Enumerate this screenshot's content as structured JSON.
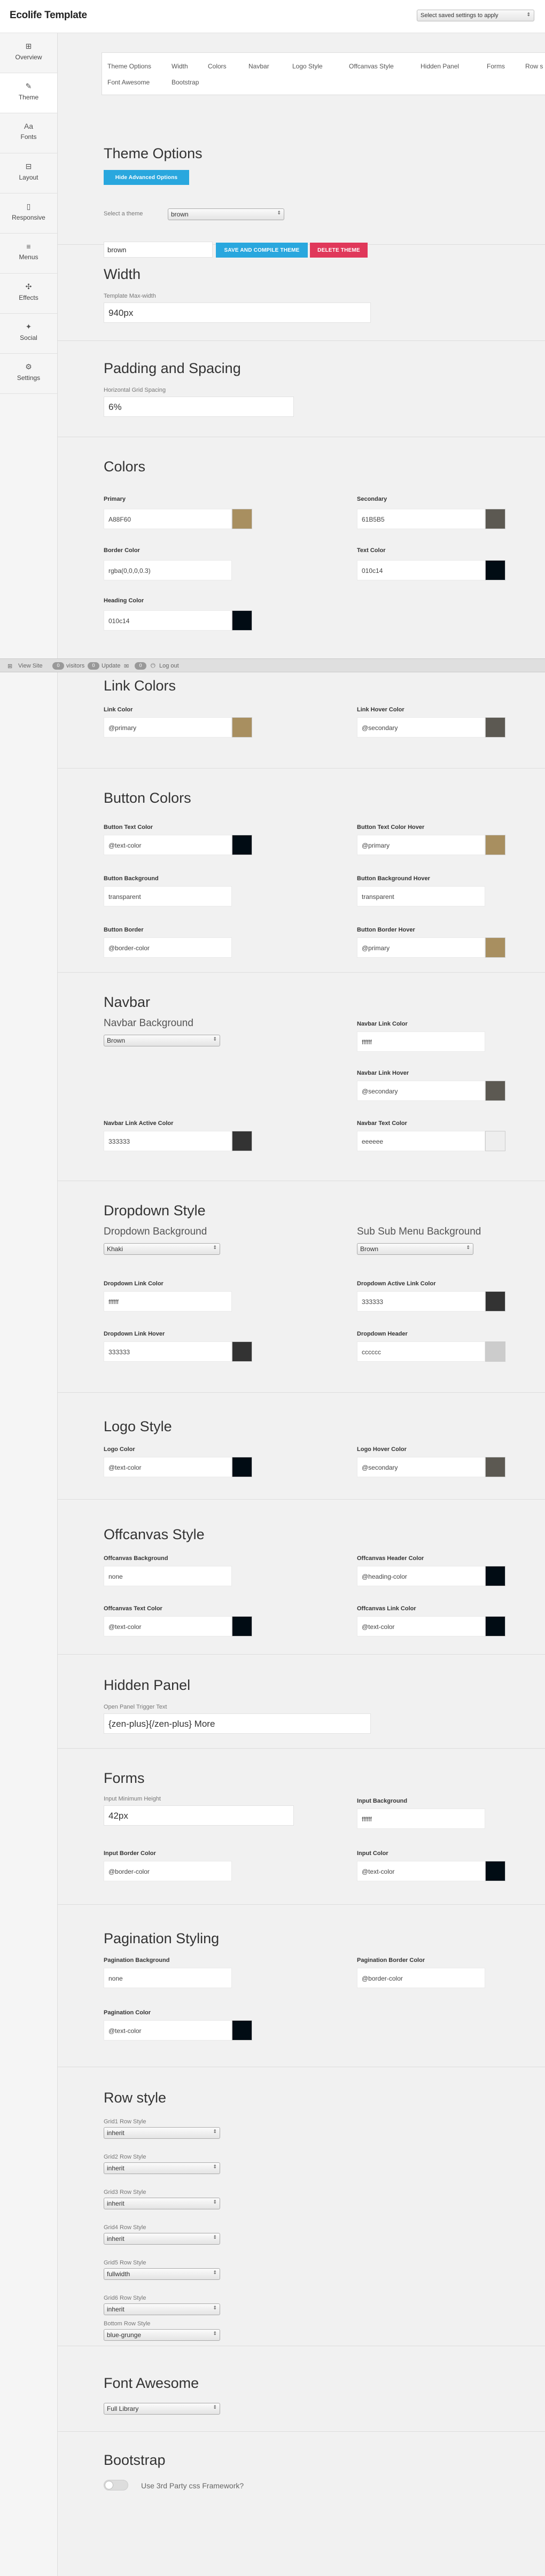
{
  "app": {
    "title": "Ecolife Template"
  },
  "saved_settings": {
    "label": "Select saved settings to apply"
  },
  "sidebar": [
    {
      "label": "Overview",
      "icon": "grid-icon"
    },
    {
      "label": "Theme",
      "icon": "brush-icon"
    },
    {
      "label": "Fonts",
      "icon": "font-icon"
    },
    {
      "label": "Layout",
      "icon": "layout-icon"
    },
    {
      "label": "Responsive",
      "icon": "responsive-icon"
    },
    {
      "label": "Menus",
      "icon": "menu-icon"
    },
    {
      "label": "Effects",
      "icon": "effects-icon"
    },
    {
      "label": "Social",
      "icon": "twitter-icon"
    },
    {
      "label": "Settings",
      "icon": "gear-icon"
    }
  ],
  "tabs": [
    "Theme Options",
    "Width",
    "Colors",
    "Navbar",
    "Logo Style",
    "Offcanvas Style",
    "Hidden Panel",
    "Forms",
    "Row s",
    "Font Awesome",
    "Bootstrap"
  ],
  "theme_options": {
    "title": "Theme Options",
    "hide_advanced": "Hide Advanced Options",
    "select_label": "Select a theme",
    "select_value": "brown",
    "name_value": "brown",
    "save_compile": "SAVE AND COMPILE THEME",
    "delete": "DELETE THEME"
  },
  "width": {
    "title": "Width",
    "label": "Template Max-width",
    "value": "940px"
  },
  "padding": {
    "title": "Padding and Spacing",
    "label": "Horizontal Grid Spacing",
    "value": "6%"
  },
  "colors": {
    "title": "Colors",
    "primary_label": "Primary",
    "primary_value": "A88F60",
    "primary_color": "#a88f60",
    "secondary_label": "Secondary",
    "secondary_value": "61B5B5",
    "secondary_color": "#5c5952",
    "border_label": "Border Color",
    "border_value": "rgba(0,0,0,0.3)",
    "text_label": "Text Color",
    "text_value": "010c14",
    "text_color": "#010c14",
    "heading_label": "Heading Color",
    "heading_value": "010c14",
    "heading_color": "#010c14"
  },
  "divider": {
    "view_site": "View Site",
    "visitors_count": "0",
    "visitors_label": "visitors",
    "updates_count": "0",
    "updates_label": "Update",
    "comments_count": "0",
    "log_out": "Log out"
  },
  "link_colors": {
    "title": "Link Colors",
    "link_label": "Link Color",
    "link_value": "@primary",
    "link_color": "#a88f60",
    "hover_label": "Link Hover Color",
    "hover_value": "@secondary",
    "hover_color": "#5c5952"
  },
  "button_colors": {
    "title": "Button Colors",
    "text_label": "Button Text Color",
    "text_value": "@text-color",
    "text_color": "#010c14",
    "text_hover_label": "Button Text Color Hover",
    "text_hover_value": "@primary",
    "text_hover_color": "#a88f60",
    "bg_label": "Button Background",
    "bg_value": "transparent",
    "bg_hover_label": "Button Background Hover",
    "bg_hover_value": "transparent",
    "border_label": "Button Border",
    "border_value": "@border-color",
    "border_hover_label": "Button Border Hover",
    "border_hover_value": "@primary",
    "border_hover_color": "#a88f60"
  },
  "navbar": {
    "title": "Navbar",
    "bg_label": "Navbar Background",
    "bg_value": "Brown",
    "link_label": "Navbar Link Color",
    "link_value": "ffffff",
    "hover_label": "Navbar Link Hover",
    "hover_value": "@secondary",
    "hover_color": "#5c5952",
    "active_label": "Navbar Link Active Color",
    "active_value": "333333",
    "active_color": "#333333",
    "text_label": "Navbar Text Color",
    "text_value": "eeeeee",
    "text_color": "#eeeeee"
  },
  "dropdown": {
    "title": "Dropdown Style",
    "bg_label": "Dropdown Background",
    "bg_value": "Khaki",
    "sub_label": "Sub Sub Menu Background",
    "sub_value": "Brown",
    "link_label": "Dropdown Link Color",
    "link_value": "ffffff",
    "active_label": "Dropdown Active Link Color",
    "active_value": "333333",
    "active_color": "#333333",
    "hover_label": "Dropdown Link Hover",
    "hover_value": "333333",
    "hover_color": "#333333",
    "header_label": "Dropdown Header",
    "header_value": "cccccc",
    "header_color": "#cccccc"
  },
  "logo": {
    "title": "Logo Style",
    "color_label": "Logo Color",
    "color_value": "@text-color",
    "color_color": "#010c14",
    "hover_label": "Logo Hover Color",
    "hover_value": "@secondary",
    "hover_color": "#5c5952"
  },
  "offcanvas": {
    "title": "Offcanvas Style",
    "bg_label": "Offcanvas Background",
    "bg_value": "none",
    "header_label": "Offcanvas Header Color",
    "header_value": "@heading-color",
    "header_color": "#010c14",
    "text_label": "Offcanvas Text Color",
    "text_value": "@text-color",
    "text_color": "#010c14",
    "link_label": "Offcanvas Link Color",
    "link_value": "@text-color",
    "link_color": "#010c14"
  },
  "hidden_panel": {
    "title": "Hidden Panel",
    "label": "Open Panel Trigger Text",
    "value": "{zen-plus}{/zen-plus} More"
  },
  "forms": {
    "title": "Forms",
    "height_label": "Input Minimum Height",
    "height_value": "42px",
    "bg_label": "Input Background",
    "bg_value": "ffffff",
    "border_label": "Input Border Color",
    "border_value": "@border-color",
    "color_label": "Input Color",
    "color_value": "@text-color",
    "color_color": "#010c14"
  },
  "pagination": {
    "title": "Pagination Styling",
    "bg_label": "Pagination Background",
    "bg_value": "none",
    "border_label": "Pagination Border Color",
    "border_value": "@border-color",
    "color_label": "Pagination Color",
    "color_value": "@text-color",
    "color_color": "#010c14"
  },
  "row_style": {
    "title": "Row style",
    "rows": [
      {
        "label": "Grid1 Row Style",
        "value": "inherit"
      },
      {
        "label": "Grid2 Row Style",
        "value": "inherit"
      },
      {
        "label": "Grid3 Row Style",
        "value": "inherit"
      },
      {
        "label": "Grid4 Row Style",
        "value": "inherit"
      },
      {
        "label": "Grid5 Row Style",
        "value": "fullwidth"
      },
      {
        "label": "Grid6 Row Style",
        "value": "inherit"
      },
      {
        "label": "Bottom Row Style",
        "value": "blue-grunge"
      }
    ]
  },
  "font_awesome": {
    "title": "Font Awesome",
    "value": "Full Library"
  },
  "bootstrap": {
    "title": "Bootstrap",
    "label": "Use 3rd Party css Framework?"
  }
}
